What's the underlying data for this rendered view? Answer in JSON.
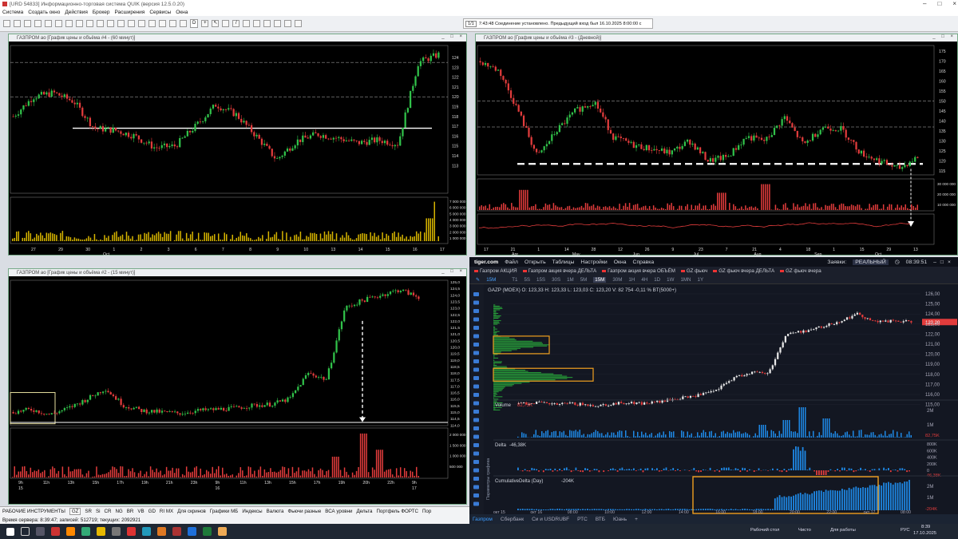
{
  "app": {
    "title": "[URD 54833] Информационно-торговая система QUIK (версия 12.5.0.20)",
    "menu": [
      "Система",
      "Создать окно",
      "Действия",
      "Брокер",
      "Расширения",
      "Сервисы",
      "Окна"
    ],
    "toolbar_interval": "D"
  },
  "status_bar": {
    "counter": "1/1",
    "message": "7:43:48  Соединение установлено. Предыдущий вход был 16.10.2025 8:00:00 с"
  },
  "windows": {
    "w4": {
      "title": "ГАЗПРОМ ао [График цены и объёма #4 - (60 минут)]",
      "price_ticks": [
        "124",
        "123",
        "122",
        "121",
        "120",
        "119",
        "118",
        "117",
        "116",
        "115",
        "114",
        "113"
      ],
      "vol_ticks": [
        "7 000 000",
        "6 000 000",
        "5 000 000",
        "4 000 000",
        "3 000 000",
        "2 000 000",
        "1 000 000"
      ],
      "x_ticks": [
        "27",
        "29",
        "30",
        "1",
        "2",
        "3",
        "6",
        "7",
        "8",
        "9",
        "10",
        "13",
        "14",
        "15",
        "16",
        "17"
      ],
      "x_sub": "Oct"
    },
    "w3": {
      "title": "ГАЗПРОМ ао [График цены и объёма #3 - (Дневной)]",
      "price_ticks": [
        "175",
        "170",
        "165",
        "160",
        "155",
        "150",
        "145",
        "140",
        "135",
        "130",
        "125",
        "120",
        "115"
      ],
      "vol_ticks": [
        "30 000 000",
        "20 000 000",
        "10 000 000"
      ],
      "x_ticks": [
        "17",
        "21",
        "1",
        "14",
        "28",
        "12",
        "26",
        "9",
        "23",
        "7",
        "21",
        "4",
        "18",
        "1",
        "15",
        "29",
        "13"
      ],
      "x_months": [
        "Apr",
        "May",
        "Jun",
        "Jul",
        "Aug",
        "Sep",
        "Oct"
      ]
    },
    "w2": {
      "title": "ГАЗПРОМ ао [График цены и объёма #2 - (15 минут)]",
      "price_ticks": [
        "125,0",
        "124,5",
        "124,0",
        "123,5",
        "123,0",
        "122,5",
        "122,0",
        "121,5",
        "121,0",
        "120,5",
        "120,0",
        "119,5",
        "119,0",
        "118,5",
        "118,0",
        "117,5",
        "117,0",
        "116,5",
        "116,0",
        "115,5",
        "115,0",
        "114,5",
        "114,0"
      ],
      "vol_ticks": [
        "2 000 000",
        "1 500 000",
        "1 000 000",
        "500 000"
      ],
      "x_ticks": [
        "9h",
        "11h",
        "13h",
        "15h",
        "17h",
        "19h",
        "21h",
        "23h",
        "9h",
        "11h",
        "13h",
        "15h",
        "17h",
        "19h",
        "20h",
        "22h",
        "9h"
      ],
      "x_days": [
        "15",
        "16",
        "17"
      ]
    }
  },
  "bottom_tabs": [
    "РАБОЧИЕ ИНСТРУМЕНТЫ",
    "GZ",
    "SR",
    "Si",
    "CR",
    "NG",
    "BR",
    "VB",
    "GD",
    "RI MX",
    "Для скринов",
    "Графики МБ",
    "Индексы",
    "Валюта",
    "Фьючи разные",
    "ВСА уровни",
    "Дельта",
    "Портфель ФОРТС",
    "Пор"
  ],
  "server_line": "Время сервера: 8:39:47; записей: 512719; текущих: 2092921",
  "tiger": {
    "brand": "tiger.com",
    "menu": [
      "Файл",
      "Открыть",
      "Таблицы",
      "Настройки",
      "Окна",
      "Справка"
    ],
    "orders_label": "Заявки:",
    "mode": "РЕАЛЬНЫЙ",
    "time": "08:39:51",
    "tabs": [
      "Газпром АКЦИЯ",
      "Газпром акция вчера ДЕЛЬТА",
      "Газпром акция вчера ОБЪЁМ",
      "GZ фьюч",
      "GZ фьюч вчера ДЕЛЬТА",
      "GZ фьюч вчера"
    ],
    "timeframes": [
      "T1",
      "5S",
      "15S",
      "30S",
      "1M",
      "5M",
      "15M",
      "30M",
      "1H",
      "4H",
      "1D",
      "1W",
      "1MN",
      "1Y"
    ],
    "active_tf": "15M",
    "interval": "15M",
    "ohlc": "GAZP (MOEX)  O: 123,33  H: 123,33  L: 123,03  C: 123,20  V: 82 754  -0,11 %   BT(5000+)",
    "price_ticks": [
      "126,00",
      "125,00",
      "124,00",
      "123,00",
      "122,00",
      "121,00",
      "120,00",
      "119,00",
      "118,00",
      "117,00",
      "116,00",
      "115,00"
    ],
    "price_now": "123,20",
    "volume_label": "Volume",
    "volume_value": "82,75K",
    "volume_ticks": [
      "2M",
      "1M"
    ],
    "volume_now": "82,75K",
    "delta_label": "Delta",
    "delta_value": "-46,38K",
    "delta_ticks": [
      "800K",
      "600K",
      "400K",
      "200K",
      "0"
    ],
    "delta_now": "-46,38K",
    "cum_label": "CumulativeDelta (Day)",
    "cum_value": "-204K",
    "cum_ticks": [
      "2M",
      "1M"
    ],
    "cum_now": "-204K",
    "x_ticks": [
      "окт 15",
      "окт 16",
      "08:00",
      "10:00",
      "12:00",
      "14:00",
      "16:00",
      "18:00",
      "20:00",
      "22:00",
      "окт 17",
      "08:00"
    ],
    "side_label": "Параметры графика",
    "status_tabs": [
      "Газпром",
      "Сбербанк",
      "Си и USDRUBF",
      "РТС",
      "ВТБ",
      "Юань",
      "+"
    ]
  },
  "taskbar": {
    "desktop1": "Рабочий стол",
    "desktop2": "Чисто",
    "desktop3": "Для работы",
    "lang": "РУС",
    "time": "8:39",
    "date": "17.10.2025"
  }
}
